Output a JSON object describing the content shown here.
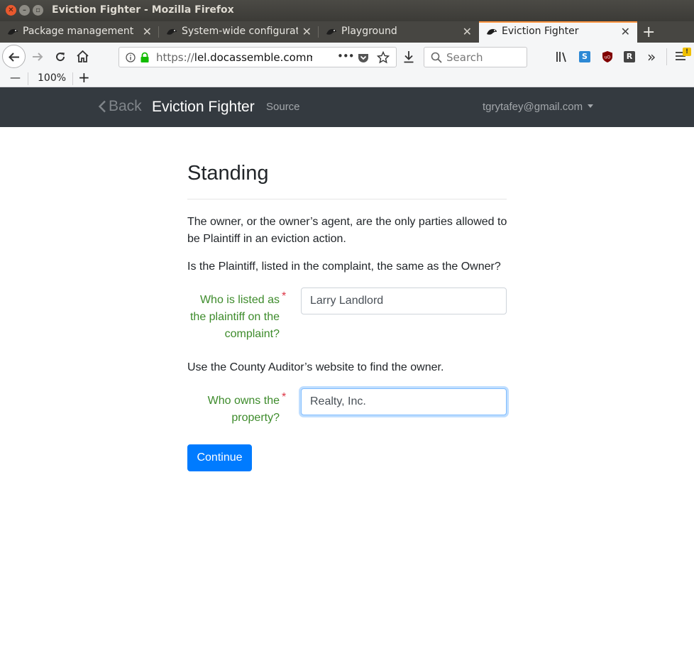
{
  "window": {
    "title": "Eviction Fighter - Mozilla Firefox"
  },
  "tabs": [
    {
      "label": "Package management",
      "active": false
    },
    {
      "label": "System-wide configurat",
      "active": false
    },
    {
      "label": "Playground",
      "active": false
    },
    {
      "label": "Eviction Fighter",
      "active": true
    }
  ],
  "toolbar": {
    "url_prefix": "https://",
    "url_host": "lel.docassemble.commu",
    "more_glyph": "•••",
    "search_placeholder": "Search",
    "zoom_level": "100%",
    "zoom_minus": "—",
    "zoom_plus": "+"
  },
  "app": {
    "back_label": "Back",
    "title": "Eviction Fighter",
    "source_label": "Source",
    "user_email": "tgrytafey@gmail.com"
  },
  "page": {
    "heading": "Standing",
    "intro": "The owner, or the owner’s agent, are the only parties allowed to be Plaintiff in an eviction action.",
    "question": "Is the Plaintiff, listed in the complaint, the same as the Owner?",
    "field1_label": "Who is listed as the plaintiff on the complaint?",
    "field1_value": "Larry Landlord",
    "auditor_note": "Use the County Auditor’s website to find the owner.",
    "field2_label": "Who owns the property?",
    "field2_value": "Realty, Inc.",
    "required_mark": "*",
    "continue_label": "Continue"
  },
  "colors": {
    "app_navbar": "#343a40",
    "label_green": "#3d8b2b",
    "required_red": "#dc3545",
    "primary_button": "#007bff",
    "active_tab_accent": "#ff9540"
  },
  "icons": [
    "close-window-icon",
    "minimize-window-icon",
    "maximize-window-icon",
    "docassemble-favicon",
    "back-arrow-icon",
    "forward-arrow-icon",
    "reload-icon",
    "home-icon",
    "info-icon",
    "lock-icon",
    "page-actions-icon",
    "pocket-icon",
    "bookmark-star-icon",
    "download-icon",
    "search-icon",
    "library-icon",
    "screenshot-icon",
    "ublock-icon",
    "r-extension-icon",
    "overflow-icon",
    "menu-icon",
    "chevron-left-icon",
    "caret-down-icon"
  ]
}
